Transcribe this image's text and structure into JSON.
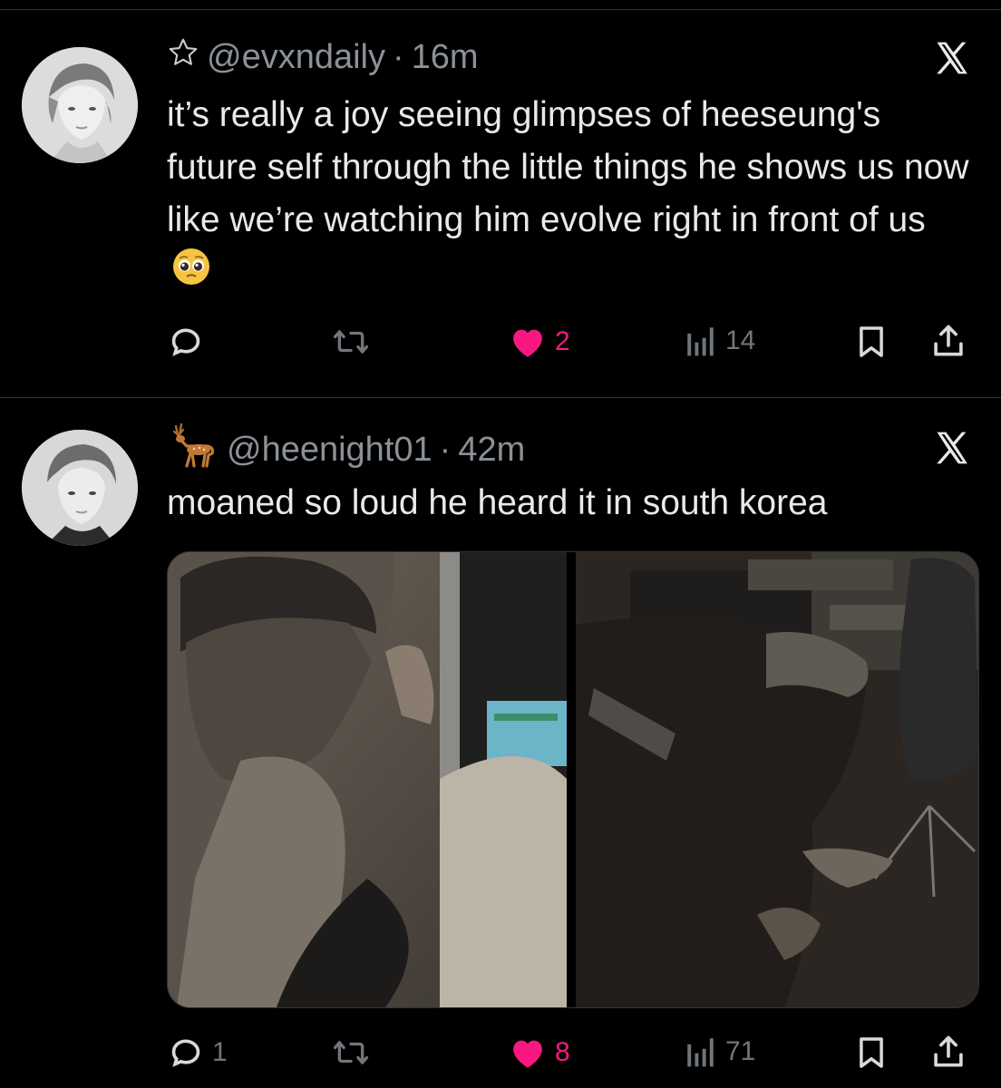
{
  "tweets": [
    {
      "handle": "@evxndaily",
      "time": "16m",
      "text": "it’s really a joy seeing glimpses of heeseung's future self through the little things he shows us now like we’re watching him evolve right in front of us",
      "emoji": "pleading-face",
      "replies": "",
      "likes": "2",
      "views": "14"
    },
    {
      "handle": "@heenight01",
      "time": "42m",
      "text": "moaned so loud he heard it in south korea",
      "replies": "1",
      "likes": "8",
      "views": "71"
    }
  ],
  "separator": "·",
  "colors": {
    "like": "#f91880",
    "muted": "#71767b",
    "text": "#e7e9ea",
    "background": "#000000"
  },
  "icons": [
    "star-outline-icon",
    "deer-emoji-icon",
    "x-logo-icon",
    "reply-icon",
    "retweet-icon",
    "heart-filled-icon",
    "views-icon",
    "bookmark-icon",
    "share-icon"
  ]
}
